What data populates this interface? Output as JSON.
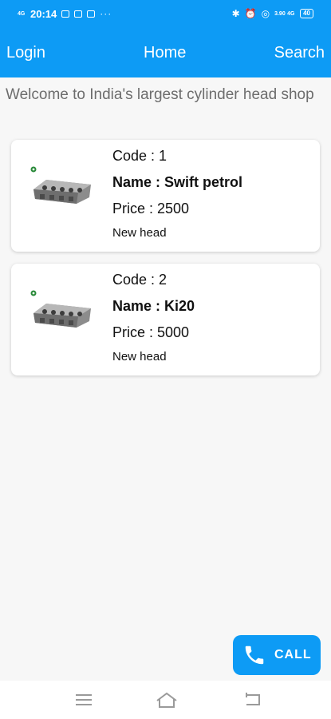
{
  "status_bar": {
    "time": "20:14",
    "network_left": "4G",
    "network_right": "4G",
    "speed": "3.90",
    "battery": "40",
    "overflow": "···"
  },
  "nav": {
    "login": "Login",
    "home": "Home",
    "search": "Search"
  },
  "welcome": "Welcome to India's largest cylinder head shop",
  "products": [
    {
      "code": "Code : 1",
      "name": "Name : Swift petrol",
      "price": "Price : 2500",
      "condition": "New head"
    },
    {
      "code": "Code : 2",
      "name": "Name : Ki20",
      "price": "Price : 5000",
      "condition": "New head"
    }
  ],
  "call_button": {
    "label": "CALL",
    "icon": "phone-icon"
  },
  "system_nav": {
    "menu_icon": "menu-icon",
    "home_icon": "home-icon",
    "back_icon": "back-icon"
  },
  "colors": {
    "accent": "#0d9bf5",
    "background": "#f7f7f7",
    "card": "#ffffff",
    "welcome_text": "#6d6d6d"
  }
}
